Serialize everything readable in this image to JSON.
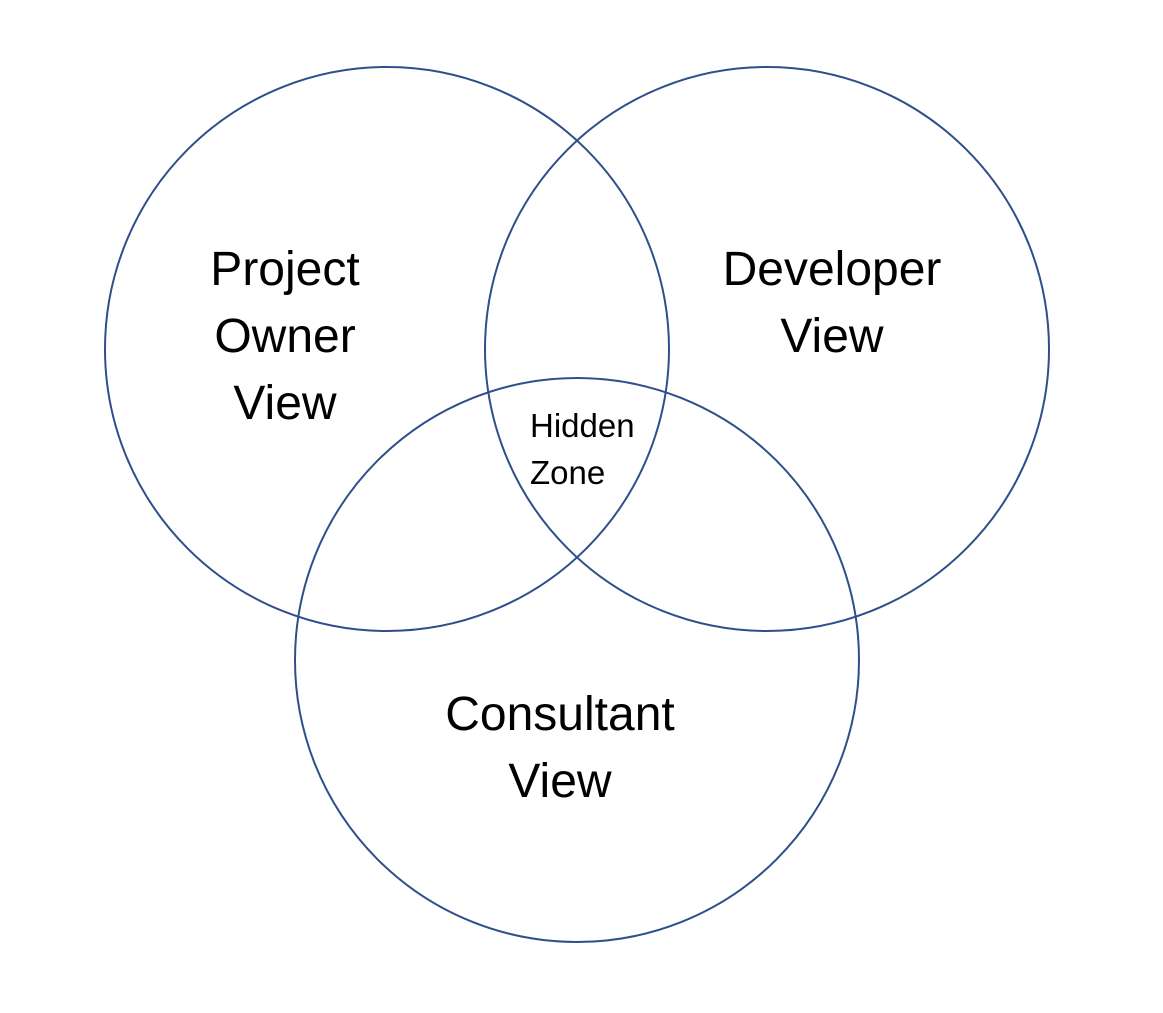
{
  "diagram": {
    "stroke_color": "#2f4f8a",
    "background": "#ffffff",
    "circles": [
      {
        "id": "owner",
        "label_lines": [
          "Project",
          "Owner",
          "View"
        ]
      },
      {
        "id": "developer",
        "label_lines": [
          "Developer",
          "View"
        ]
      },
      {
        "id": "consultant",
        "label_lines": [
          "Consultant",
          "View"
        ]
      }
    ],
    "intersection": {
      "id": "hidden",
      "label_lines": [
        "Hidden",
        "Zone"
      ]
    }
  }
}
